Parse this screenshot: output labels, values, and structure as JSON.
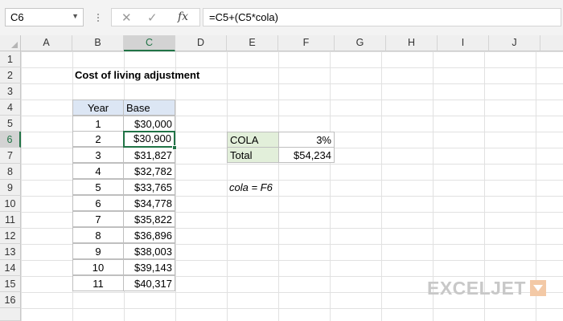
{
  "formula_bar": {
    "name_box": "C6",
    "cancel_glyph": "✕",
    "enter_glyph": "✓",
    "fx_label": "fx",
    "formula": "=C5+(C5*cola)"
  },
  "columns": [
    "A",
    "B",
    "C",
    "D",
    "E",
    "F",
    "G",
    "H",
    "I",
    "J"
  ],
  "rows": [
    "1",
    "2",
    "3",
    "4",
    "5",
    "6",
    "7",
    "8",
    "9",
    "10",
    "11",
    "12",
    "13",
    "14",
    "15",
    "16"
  ],
  "selected": {
    "column": "C",
    "row": "6"
  },
  "sheet": {
    "title": "Cost of living adjustment",
    "table": {
      "headers": {
        "year": "Year",
        "base": "Base"
      },
      "rows": [
        {
          "year": "1",
          "base": "$30,000"
        },
        {
          "year": "2",
          "base": "$30,900"
        },
        {
          "year": "3",
          "base": "$31,827"
        },
        {
          "year": "4",
          "base": "$32,782"
        },
        {
          "year": "5",
          "base": "$33,765"
        },
        {
          "year": "6",
          "base": "$34,778"
        },
        {
          "year": "7",
          "base": "$35,822"
        },
        {
          "year": "8",
          "base": "$36,896"
        },
        {
          "year": "9",
          "base": "$38,003"
        },
        {
          "year": "10",
          "base": "$39,143"
        },
        {
          "year": "11",
          "base": "$40,317"
        }
      ]
    },
    "summary": {
      "cola_label": "COLA",
      "cola_value": "3%",
      "total_label": "Total",
      "total_value": "$54,234"
    },
    "note": "cola = F6"
  },
  "logo": {
    "text": "EXCELJET"
  },
  "colors": {
    "accent_green": "#217346",
    "header_blue": "#dce6f4",
    "label_green": "#e2efda"
  }
}
